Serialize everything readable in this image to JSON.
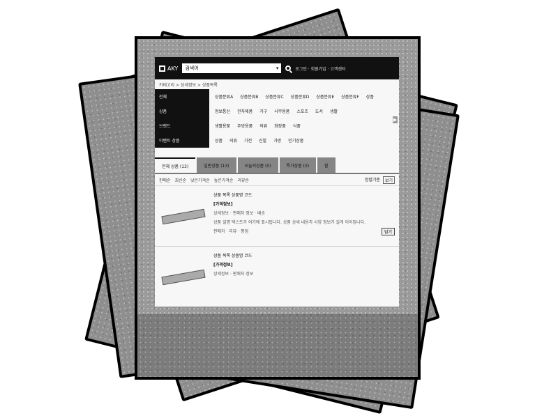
{
  "window": {
    "logo": "AKY",
    "search_value": "검색어",
    "top_links": "로그인 · 회원가입 · 고객센터"
  },
  "breadcrumb": "카테고리 > 상세정보 > 상품목록",
  "categories": {
    "side": [
      "전체",
      "상품",
      "브랜드",
      "이벤트 상품"
    ],
    "rows": [
      [
        "상품분류A",
        "상품분류B",
        "상품분류C",
        "상품분류D",
        "상품분류E",
        "상품분류F",
        "상품"
      ],
      [
        "정보통신",
        "전자제품",
        "가구",
        "사무용품",
        "스포츠",
        "도서",
        "생활"
      ],
      [
        "생활용품",
        "주방용품",
        "의류",
        "화장품",
        "식품"
      ],
      [
        "상품",
        "의류",
        "가전",
        "신발",
        "가방",
        "인기상품"
      ]
    ],
    "scroll_arrow": "▶"
  },
  "tabs": [
    {
      "label": "전체 상품 (13)",
      "active": true
    },
    {
      "label": "일반상품 (13)",
      "active": false
    },
    {
      "label": "오늘의상품 (0)",
      "active": false
    },
    {
      "label": "특가상품 (0)",
      "active": false
    },
    {
      "label": "할",
      "active": false
    }
  ],
  "filters": {
    "left": [
      "판매순",
      "최신순",
      "낮은가격순",
      "높은가격순",
      "리뷰순"
    ],
    "sort_label": "정렬기준",
    "view_label": "보기"
  },
  "items": [
    {
      "title": "상품 목록 상품명 코드",
      "price": "[가격정보]",
      "meta": "상세정보 · 판매자 정보 · 배송",
      "desc": "상품 설명 텍스트가 여기에 표시됩니다. 상품 상세 내용과 사양 정보가 길게 이어집니다.",
      "footer_left": "판매처 · 리뷰 · 평점",
      "cart": "담기"
    },
    {
      "title": "상품 목록 상품명 코드",
      "price": "[가격정보]",
      "meta": "상세정보 · 판매자 정보",
      "desc": "",
      "footer_left": "",
      "cart": ""
    }
  ]
}
